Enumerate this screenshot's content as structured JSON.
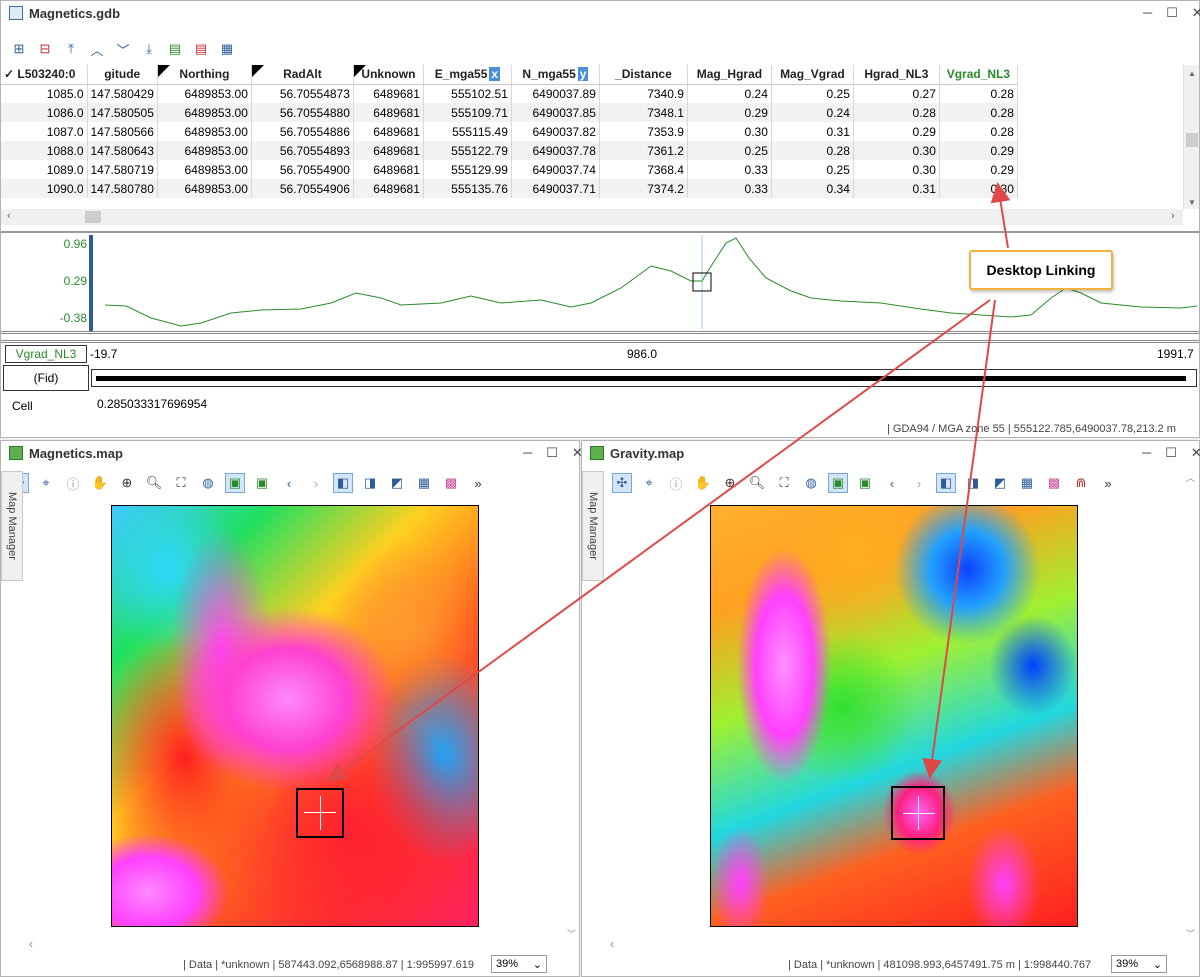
{
  "gdb": {
    "title": "Magnetics.gdb",
    "line_label": "L503240:0",
    "columns": [
      "gitude",
      "Northing",
      "RadAlt",
      "Unknown",
      "E_mga55",
      "N_mga55",
      "_Distance",
      "Mag_Hgrad",
      "Mag_Vgrad",
      "Hgrad_NL3",
      "Vgrad_NL3"
    ],
    "col_x_badge": "x",
    "col_y_badge": "y",
    "rows": [
      [
        "1085.0",
        "147.580429",
        "6489853.00",
        "56.70554873",
        "6489681",
        "555102.51",
        "6490037.89",
        "7340.9",
        "0.24",
        "0.25",
        "0.27",
        "0.28"
      ],
      [
        "1086.0",
        "147.580505",
        "6489853.00",
        "56.70554880",
        "6489681",
        "555109.71",
        "6490037.85",
        "7348.1",
        "0.29",
        "0.24",
        "0.28",
        "0.28"
      ],
      [
        "1087.0",
        "147.580566",
        "6489853.00",
        "56.70554886",
        "6489681",
        "555115.49",
        "6490037.82",
        "7353.9",
        "0.30",
        "0.31",
        "0.29",
        "0.28"
      ],
      [
        "1088.0",
        "147.580643",
        "6489853.00",
        "56.70554893",
        "6489681",
        "555122.79",
        "6490037.78",
        "7361.2",
        "0.25",
        "0.28",
        "0.30",
        "0.29"
      ],
      [
        "1089.0",
        "147.580719",
        "6489853.00",
        "56.70554900",
        "6489681",
        "555129.99",
        "6490037.74",
        "7368.4",
        "0.33",
        "0.25",
        "0.30",
        "0.29"
      ],
      [
        "1090.0",
        "147.580780",
        "6489853.00",
        "56.70554906",
        "6489681",
        "555135.76",
        "6490037.71",
        "7374.2",
        "0.33",
        "0.34",
        "0.31",
        "0.30"
      ]
    ],
    "profile": {
      "y_max": "0.96",
      "y_mid": "0.29",
      "y_min": "-0.38",
      "channel": "Vgrad_NL3",
      "fid_label": "(Fid)",
      "x_start": "-19.7",
      "x_mid": "986.0",
      "x_end": "1991.7"
    },
    "cell_label": "Cell",
    "cell_value": "0.285033317696954",
    "status": "| GDA94 / MGA zone 55  | 555122.785,6490037.78,213.2 m"
  },
  "callout": "Desktop Linking",
  "mag_map": {
    "title": "Magnetics.map",
    "manager": "Map Manager",
    "status": "| Data  | *unknown  | 587443.092,6568988.87  | 1:995997.619",
    "zoom": "39%"
  },
  "grav_map": {
    "title": "Gravity.map",
    "manager": "Map Manager",
    "status": "| Data  | *unknown  | 481098.993,6457491.75 m  | 1:998440.767",
    "zoom": "39%"
  },
  "colors": {
    "accent": "#2d5d99",
    "callout_border": "#f2b33d",
    "arrow": "#e04848",
    "profile": "#2a8a2a"
  }
}
